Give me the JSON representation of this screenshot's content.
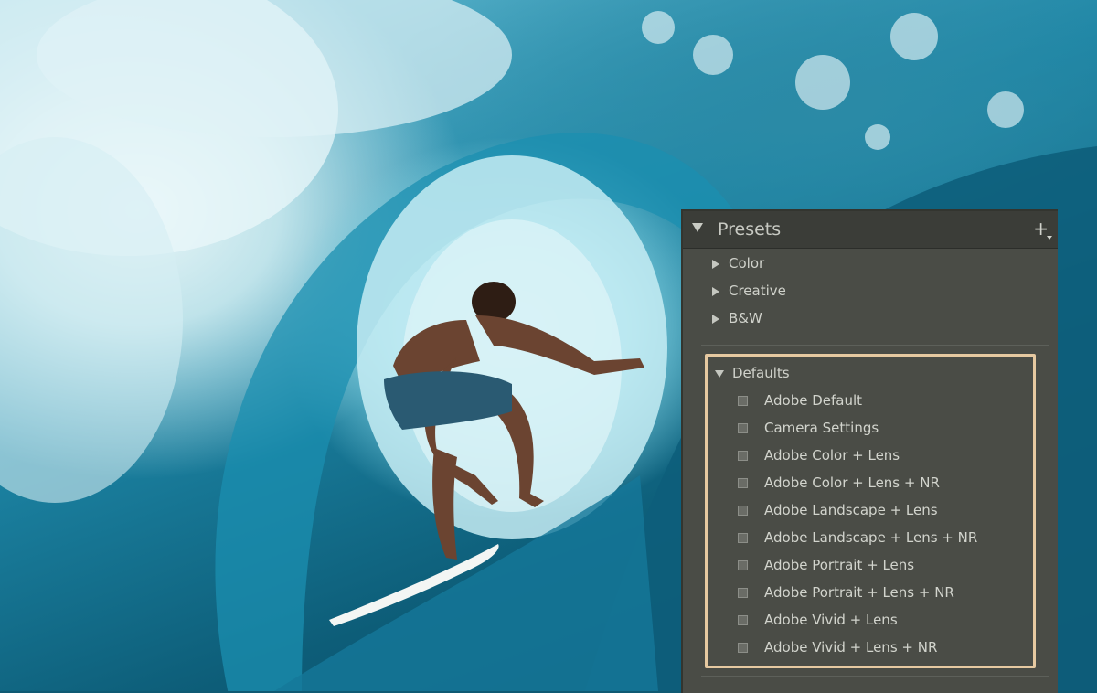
{
  "panel": {
    "title": "Presets",
    "add_symbol": "+",
    "groups": [
      {
        "label": "Color",
        "state": "collapsed"
      },
      {
        "label": "Creative",
        "state": "collapsed"
      },
      {
        "label": "B&W",
        "state": "collapsed"
      },
      {
        "label": "Defaults",
        "state": "expanded"
      }
    ],
    "defaults_presets": [
      "Adobe Default",
      "Camera Settings",
      "Adobe Color + Lens",
      "Adobe Color + Lens + NR",
      "Adobe Landscape + Lens",
      "Adobe Landscape + Lens + NR",
      "Adobe Portrait + Lens",
      "Adobe Portrait + Lens + NR",
      "Adobe Vivid + Lens",
      "Adobe Vivid + Lens + NR"
    ]
  },
  "colors": {
    "panel_bg": "#4a4c46",
    "header_bg": "#3b3d38",
    "highlight_border": "#e6c9a1",
    "text": "#d2d4cd"
  },
  "icons": [
    "collapse-triangle-icon",
    "disclosure-arrow-icon",
    "preset-checkbox-icon",
    "add-preset-icon"
  ]
}
